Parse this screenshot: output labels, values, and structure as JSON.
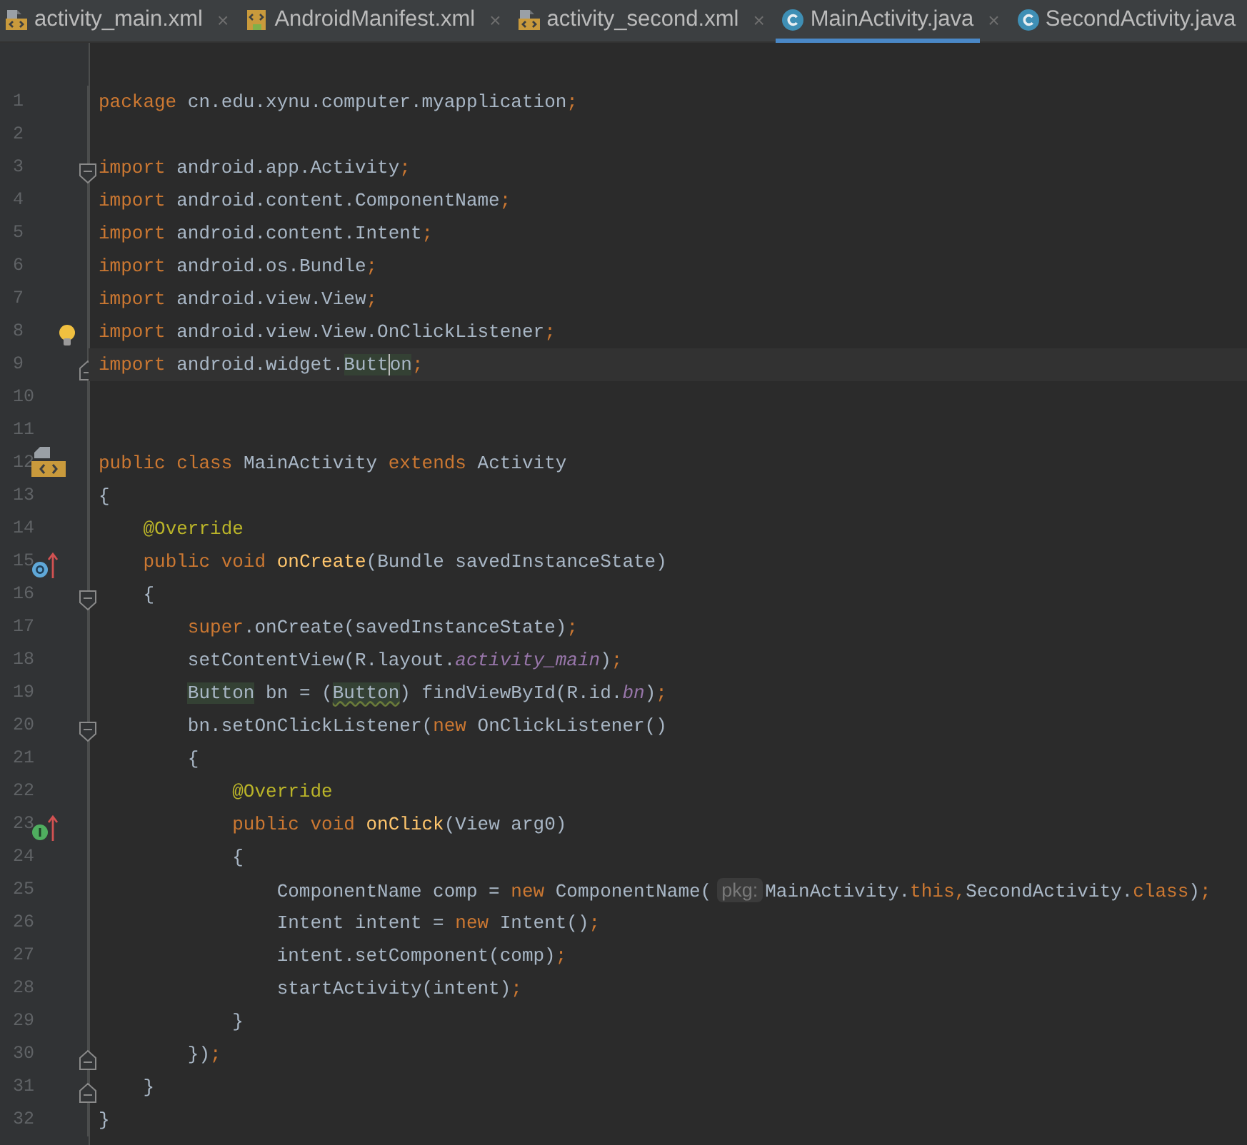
{
  "tabs": [
    {
      "label": "activity_main.xml",
      "kind": "xml",
      "close": "×",
      "selected": false
    },
    {
      "label": "AndroidManifest.xml",
      "kind": "manifest",
      "close": "×",
      "selected": false
    },
    {
      "label": "activity_second.xml",
      "kind": "xml",
      "close": "×",
      "selected": false
    },
    {
      "label": "MainActivity.java",
      "kind": "class",
      "close": "×",
      "selected": true
    },
    {
      "label": "SecondActivity.java",
      "kind": "class",
      "selected": false
    }
  ],
  "lines": [
    {
      "number": "1",
      "tokens": [
        {
          "text": "package",
          "kind": "keyword"
        },
        {
          "text": " cn.edu.xynu.computer.myapplication",
          "kind": "plain"
        },
        {
          "text": ";",
          "kind": "punct"
        }
      ]
    },
    {
      "number": "2"
    },
    {
      "number": "3",
      "markers": [
        {
          "kind": "fold-start"
        }
      ],
      "tokens": [
        {
          "text": "import",
          "kind": "keyword"
        },
        {
          "text": " android.app.Activity",
          "kind": "plain"
        },
        {
          "text": ";",
          "kind": "punct"
        }
      ]
    },
    {
      "number": "4",
      "tokens": [
        {
          "text": "import",
          "kind": "keyword"
        },
        {
          "text": " android.content.ComponentName",
          "kind": "plain"
        },
        {
          "text": ";",
          "kind": "punct"
        }
      ]
    },
    {
      "number": "5",
      "tokens": [
        {
          "text": "import",
          "kind": "keyword"
        },
        {
          "text": " android.content.Intent",
          "kind": "plain"
        },
        {
          "text": ";",
          "kind": "punct"
        }
      ]
    },
    {
      "number": "6",
      "tokens": [
        {
          "text": "import",
          "kind": "keyword"
        },
        {
          "text": " android.os.Bundle",
          "kind": "plain"
        },
        {
          "text": ";",
          "kind": "punct"
        }
      ]
    },
    {
      "number": "7",
      "tokens": [
        {
          "text": "import",
          "kind": "keyword"
        },
        {
          "text": " android.view.View",
          "kind": "plain"
        },
        {
          "text": ";",
          "kind": "punct"
        }
      ]
    },
    {
      "number": "8",
      "bulb": true,
      "tokens": [
        {
          "text": "import",
          "kind": "keyword"
        },
        {
          "text": " android.view.View.OnClickListener",
          "kind": "plain"
        },
        {
          "text": ";",
          "kind": "punct"
        }
      ]
    },
    {
      "number": "9",
      "markers": [
        {
          "kind": "fold-end"
        }
      ],
      "current": true,
      "tokens": [
        {
          "text": "import",
          "kind": "keyword"
        },
        {
          "text": " android.widget.",
          "kind": "plain"
        },
        {
          "text": "Butt",
          "kind": "usage",
          "caret": true
        },
        {
          "text": "on",
          "kind": "usage"
        },
        {
          "text": ";",
          "kind": "punct"
        }
      ]
    },
    {
      "number": "10"
    },
    {
      "number": "11"
    },
    {
      "number": "12",
      "markers": [
        {
          "kind": "class"
        }
      ],
      "tokens": [
        {
          "text": "public class",
          "kind": "keyword"
        },
        {
          "text": " MainActivity ",
          "kind": "plain"
        },
        {
          "text": "extends",
          "kind": "keyword"
        },
        {
          "text": " Activity",
          "kind": "plain"
        }
      ]
    },
    {
      "number": "13",
      "tokens": [
        {
          "text": "{",
          "kind": "plain"
        }
      ]
    },
    {
      "number": "14",
      "tokens": [
        {
          "text": "    @Override",
          "kind": "annotation"
        }
      ]
    },
    {
      "number": "15",
      "markers": [
        {
          "kind": "override"
        }
      ],
      "tokens": [
        {
          "text": "    public void ",
          "kind": "keyword"
        },
        {
          "text": "onCreate",
          "kind": "declaration"
        },
        {
          "text": "(Bundle savedInstanceState)",
          "kind": "plain"
        }
      ]
    },
    {
      "number": "16",
      "markers": [
        {
          "kind": "fold-start"
        }
      ],
      "tokens": [
        {
          "text": "    {",
          "kind": "plain"
        }
      ]
    },
    {
      "number": "17",
      "tokens": [
        {
          "text": "        super",
          "kind": "keyword"
        },
        {
          "text": ".onCreate(savedInstanceState)",
          "kind": "plain"
        },
        {
          "text": ";",
          "kind": "punct"
        }
      ]
    },
    {
      "number": "18",
      "tokens": [
        {
          "text": "        setContentView(R.layout.",
          "kind": "plain"
        },
        {
          "text": "activity_main",
          "kind": "field"
        },
        {
          "text": ")",
          "kind": "plain"
        },
        {
          "text": ";",
          "kind": "punct"
        }
      ]
    },
    {
      "number": "19",
      "tokens": [
        {
          "text": "        Button",
          "kind": "usage"
        },
        {
          "text": " bn = (",
          "kind": "plain"
        },
        {
          "text": "Button",
          "kind": "warning"
        },
        {
          "text": ") findViewById(R.id.",
          "kind": "plain"
        },
        {
          "text": "bn",
          "kind": "field"
        },
        {
          "text": ")",
          "kind": "plain"
        },
        {
          "text": ";",
          "kind": "punct"
        }
      ]
    },
    {
      "number": "20",
      "markers": [
        {
          "kind": "fold-start"
        }
      ],
      "tokens": [
        {
          "text": "        bn.setOnClickListener(",
          "kind": "plain"
        },
        {
          "text": "new",
          "kind": "keyword"
        },
        {
          "text": " OnClickListener()",
          "kind": "plain"
        }
      ]
    },
    {
      "number": "21",
      "tokens": [
        {
          "text": "        {",
          "kind": "plain"
        }
      ]
    },
    {
      "number": "22",
      "tokens": [
        {
          "text": "            @Override",
          "kind": "annotation"
        }
      ]
    },
    {
      "number": "23",
      "markers": [
        {
          "kind": "implement"
        }
      ],
      "tokens": [
        {
          "text": "            public void ",
          "kind": "keyword"
        },
        {
          "text": "onClick",
          "kind": "declaration"
        },
        {
          "text": "(View arg0)",
          "kind": "plain"
        }
      ]
    },
    {
      "number": "24",
      "tokens": [
        {
          "text": "            {",
          "kind": "plain"
        }
      ]
    },
    {
      "number": "25",
      "tokens": [
        {
          "text": "                ComponentName comp = ",
          "kind": "plain"
        },
        {
          "text": "new",
          "kind": "keyword"
        },
        {
          "text": " ComponentName(",
          "kind": "plain"
        },
        {
          "text": "pkg:",
          "kind": "hint"
        },
        {
          "text": "MainActivity.",
          "kind": "plain"
        },
        {
          "text": "this",
          "kind": "keyword"
        },
        {
          "text": ",",
          "kind": "punct"
        },
        {
          "text": "SecondActivity.",
          "kind": "plain"
        },
        {
          "text": "class",
          "kind": "keyword"
        },
        {
          "text": ")",
          "kind": "plain"
        },
        {
          "text": ";",
          "kind": "punct"
        }
      ]
    },
    {
      "number": "26",
      "tokens": [
        {
          "text": "                Intent intent = ",
          "kind": "plain"
        },
        {
          "text": "new",
          "kind": "keyword"
        },
        {
          "text": " Intent()",
          "kind": "plain"
        },
        {
          "text": ";",
          "kind": "punct"
        }
      ]
    },
    {
      "number": "27",
      "tokens": [
        {
          "text": "                intent.setComponent(comp)",
          "kind": "plain"
        },
        {
          "text": ";",
          "kind": "punct"
        }
      ]
    },
    {
      "number": "28",
      "tokens": [
        {
          "text": "                startActivity(intent)",
          "kind": "plain"
        },
        {
          "text": ";",
          "kind": "punct"
        }
      ]
    },
    {
      "number": "29",
      "tokens": [
        {
          "text": "            }",
          "kind": "plain"
        }
      ]
    },
    {
      "number": "30",
      "markers": [
        {
          "kind": "fold-end"
        }
      ],
      "tokens": [
        {
          "text": "        })",
          "kind": "plain"
        },
        {
          "text": ";",
          "kind": "punct"
        }
      ]
    },
    {
      "number": "31",
      "markers": [
        {
          "kind": "fold-end"
        }
      ],
      "tokens": [
        {
          "text": "    }",
          "kind": "plain"
        }
      ]
    },
    {
      "number": "32",
      "tokens": [
        {
          "text": "}",
          "kind": "plain"
        }
      ]
    }
  ]
}
